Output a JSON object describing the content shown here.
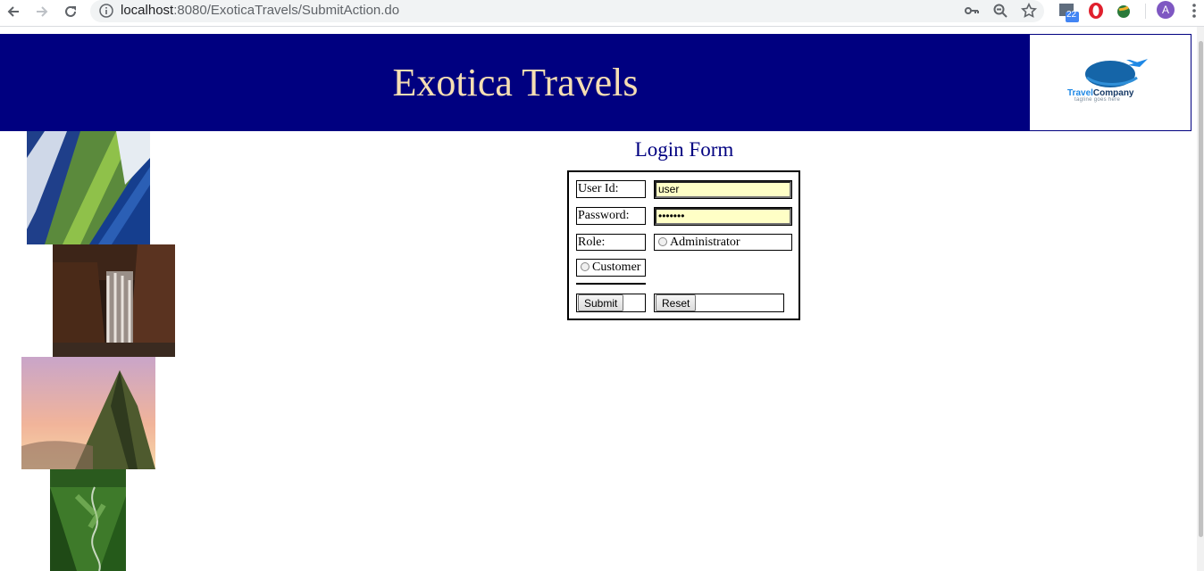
{
  "browser": {
    "url_host": "localhost",
    "url_path": ":8080/ExoticaTravels/SubmitAction.do",
    "extension_badge": "22",
    "avatar_letter": "A"
  },
  "header": {
    "title": "Exotica Travels",
    "logo": {
      "brand_part1": "Travel",
      "brand_part2": "Company",
      "tagline": "tagline goes here"
    }
  },
  "login_form": {
    "title": "Login Form",
    "user_id_label": "User Id:",
    "user_id_value": "user",
    "password_label": "Password:",
    "password_value": "•••••••",
    "role_label": "Role:",
    "role_options": [
      "Administrator",
      "Customer"
    ],
    "submit_label": "Submit",
    "reset_label": "Reset"
  },
  "colors": {
    "header_bg": "#000080",
    "header_text": "#f5deb3",
    "form_title": "#000080",
    "input_autofill": "#ffffc6"
  }
}
